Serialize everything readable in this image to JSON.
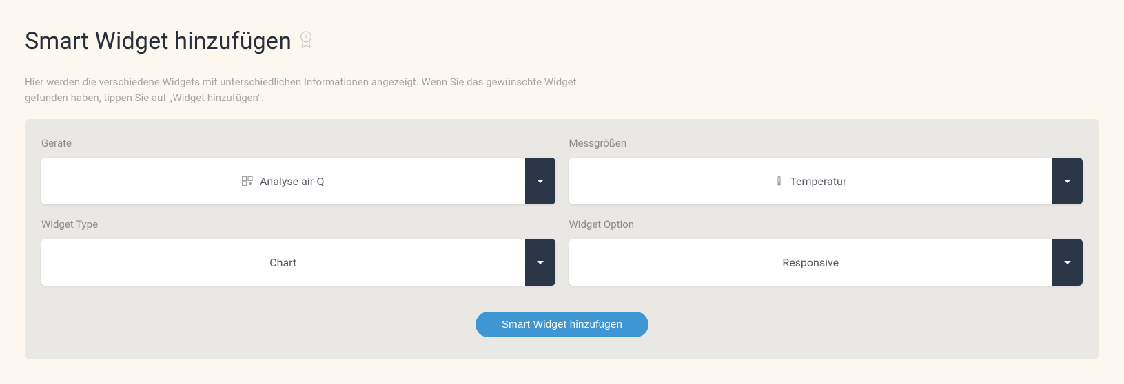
{
  "page": {
    "title": "Smart Widget hinzufügen",
    "subtitle": "Hier werden die verschiedene Widgets mit unterschiedlichen Informationen angezeigt. Wenn Sie das gewünschte Widget gefunden haben, tippen Sie auf „Widget hinzufügen\"."
  },
  "form": {
    "fields": {
      "devices": {
        "label": "Geräte",
        "value": "Analyse air-Q"
      },
      "measurements": {
        "label": "Messgrößen",
        "value": "Temperatur"
      },
      "widget_type": {
        "label": "Widget Type",
        "value": "Chart"
      },
      "widget_option": {
        "label": "Widget Option",
        "value": "Responsive"
      }
    },
    "submit_label": "Smart Widget hinzufügen"
  }
}
